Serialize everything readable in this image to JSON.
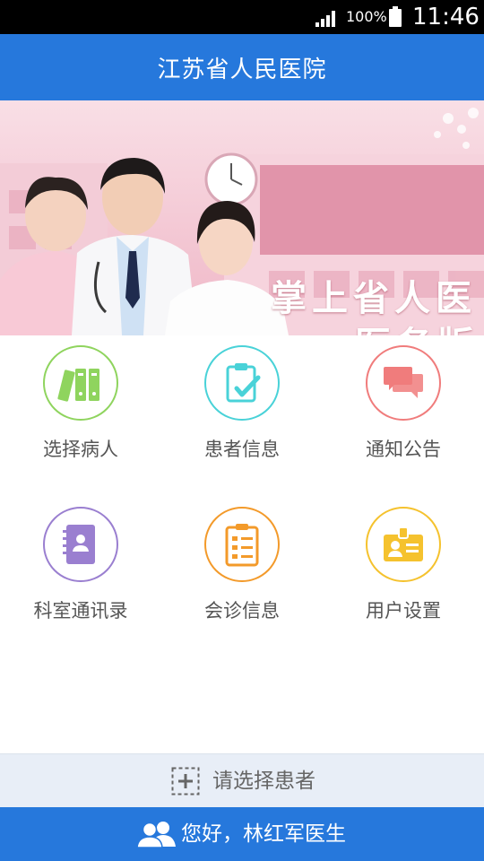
{
  "status_bar": {
    "battery_percent": "100%",
    "time": "11:46"
  },
  "header": {
    "title": "江苏省人民医院"
  },
  "banner": {
    "line1": "掌上省人医",
    "line2": "医务版"
  },
  "menu": [
    {
      "label": "选择病人",
      "icon": "binders-icon",
      "color": "#8fd45e"
    },
    {
      "label": "患者信息",
      "icon": "clipboard-check-icon",
      "color": "#49d2d8"
    },
    {
      "label": "通知公告",
      "icon": "chat-bubbles-icon",
      "color": "#f07c7c"
    },
    {
      "label": "科室通讯录",
      "icon": "address-book-icon",
      "color": "#9a7fd0"
    },
    {
      "label": "会诊信息",
      "icon": "checklist-icon",
      "color": "#f39a2a"
    },
    {
      "label": "用户设置",
      "icon": "id-badge-icon",
      "color": "#f5c22e"
    }
  ],
  "select_patient": {
    "label": "请选择患者"
  },
  "footer": {
    "greeting": "您好，林红军医生"
  },
  "colors": {
    "primary": "#2678dc",
    "select_bar_bg": "#e8eef7"
  }
}
